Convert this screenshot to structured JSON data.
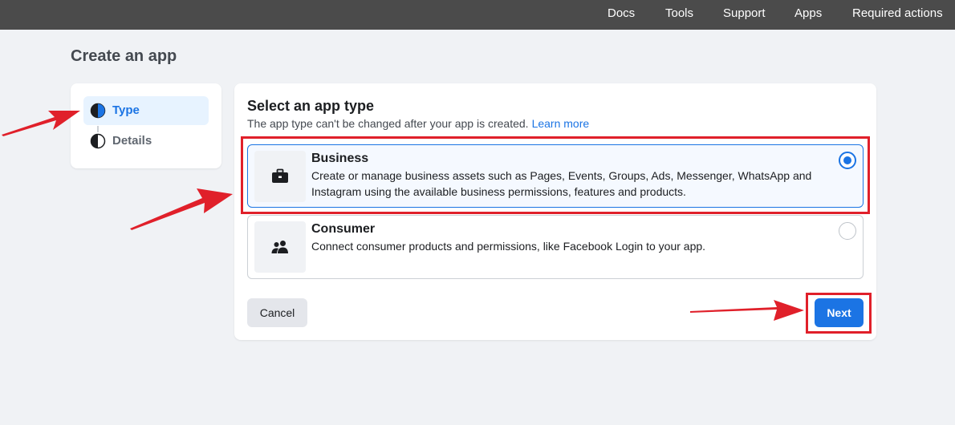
{
  "topnav": {
    "items": [
      {
        "label": "Docs"
      },
      {
        "label": "Tools"
      },
      {
        "label": "Support"
      },
      {
        "label": "Apps"
      },
      {
        "label": "Required actions"
      }
    ]
  },
  "page": {
    "title": "Create an app"
  },
  "steps": [
    {
      "label": "Type",
      "state": "active"
    },
    {
      "label": "Details",
      "state": "inactive"
    }
  ],
  "main": {
    "title": "Select an app type",
    "subtitle": "The app type can't be changed after your app is created.",
    "learn_more": "Learn more",
    "options": [
      {
        "title": "Business",
        "description": "Create or manage business assets such as Pages, Events, Groups, Ads, Messenger, WhatsApp and Instagram using the available business permissions, features and products.",
        "icon": "briefcase-icon",
        "selected": true
      },
      {
        "title": "Consumer",
        "description": "Connect consumer products and permissions, like Facebook Login to your app.",
        "icon": "people-icon",
        "selected": false
      }
    ],
    "cancel_label": "Cancel",
    "next_label": "Next"
  },
  "colors": {
    "accent": "#1b74e4",
    "topbar": "#4b4b4b",
    "annotation": "#e0202a"
  }
}
